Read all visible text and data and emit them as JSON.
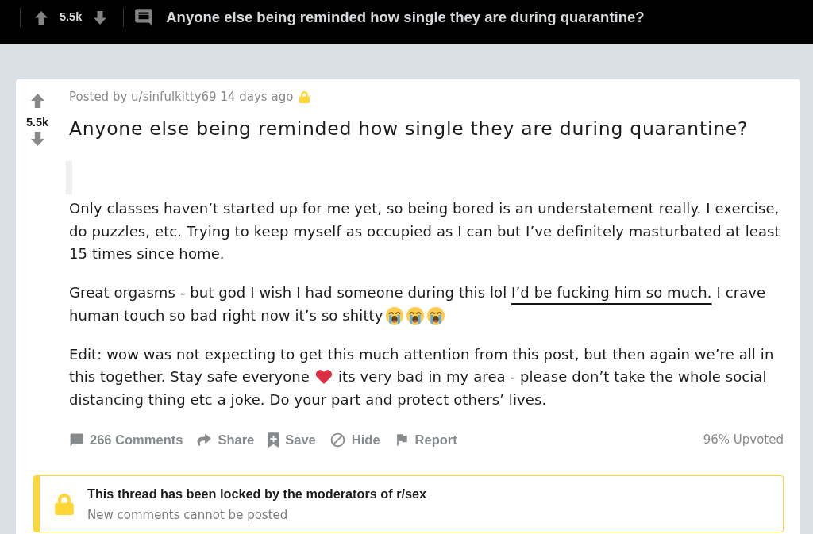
{
  "top_bar": {
    "score": "5.5k",
    "title": "Anyone else being reminded how single they are during quarantine?"
  },
  "post": {
    "score": "5.5k",
    "meta": "Posted by u/sinfulkitty69 14 days ago",
    "locked": true,
    "title": "Anyone else being reminded how single they are during quarantine?",
    "paragraphs": [
      {
        "segments": [
          {
            "kind": "text",
            "text": "Only classes haven’t started up for me yet, so being bored is an understatement really. I exercise, do puzzles, etc. Trying to keep myself as occupied as I can but I’ve definitely masturbated at least 15 times since home."
          }
        ]
      },
      {
        "segments": [
          {
            "kind": "text",
            "text": "Great orgasms - but god I wish I had someone during this lol "
          },
          {
            "kind": "underlined",
            "text": "I’d be fucking him so much."
          },
          {
            "kind": "text",
            "text": " I crave human touch so bad right now it’s so shitty"
          },
          {
            "kind": "crying_face"
          },
          {
            "kind": "crying_face"
          },
          {
            "kind": "crying_face"
          }
        ]
      },
      {
        "segments": [
          {
            "kind": "text",
            "text": "Edit: wow was not expecting to get this much attention from this post, but then again we’re all in this together. Stay safe everyone"
          },
          {
            "kind": "heart"
          },
          {
            "kind": "text",
            "text": "its very bad in my area - please don’t take the whole social distancing thing etc a joke. Do your part and protect others’ lives."
          }
        ]
      }
    ],
    "actions": [
      {
        "kind": "comments",
        "label": "266 Comments"
      },
      {
        "kind": "share",
        "label": "Share"
      },
      {
        "kind": "save",
        "label": "Save"
      },
      {
        "kind": "hide",
        "label": "Hide"
      },
      {
        "kind": "report",
        "label": "Report"
      }
    ],
    "upvote_ratio": "96% Upvoted"
  },
  "lock_notice": {
    "title": "This thread has been locked by the moderators of r/sex",
    "subtitle": "New comments cannot be posted"
  }
}
